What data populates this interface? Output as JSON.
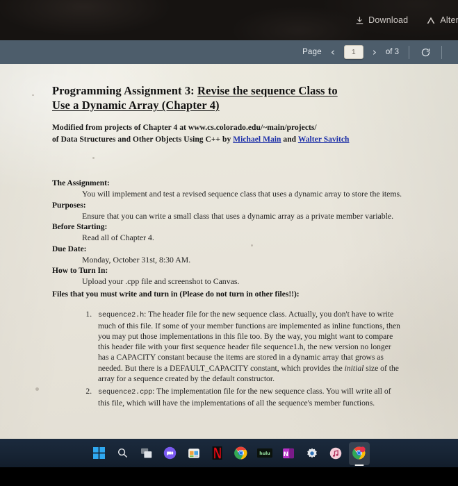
{
  "topbar": {
    "download_label": "Download",
    "alternative_label": "Alternati",
    "download_icon": "download-icon",
    "alternative_icon": "alternative-a-icon"
  },
  "viewer_toolbar": {
    "page_label": "Page",
    "prev_icon": "chevron-left-icon",
    "page_value": "1",
    "next_icon": "chevron-right-icon",
    "of_label": "of 3",
    "total_pages": 3,
    "refresh_icon": "refresh-icon"
  },
  "document": {
    "title_line1_plain": "Programming Assignment 3:  ",
    "title_line1_underlined": "Revise the sequence Class to",
    "title_line2_underlined": "Use a Dynamic Array (Chapter 4)",
    "subtitle_line1": "Modified from projects of Chapter  4  at www.cs.colorado.edu/~main/projects/",
    "subtitle_line2_pre": "of Data Structures and Other Objects Using C++  by ",
    "subtitle_link1": "Michael Main",
    "subtitle_mid": " and ",
    "subtitle_link2": "Walter Savitch",
    "sections": [
      {
        "heading": "The Assignment:",
        "body": "You will implement and test a revised sequence class that uses a dynamic array to store the items."
      },
      {
        "heading": "Purposes:",
        "body": "Ensure that you can write a small class that uses a dynamic array as a private member variable."
      },
      {
        "heading": "Before Starting:",
        "body": "Read all of Chapter 4."
      },
      {
        "heading": "Due Date:",
        "body": "Monday, October 31st, 8:30 AM."
      },
      {
        "heading": "How to Turn In:",
        "body": "Upload your .cpp file and screenshot to Canvas."
      }
    ],
    "files_heading": "Files that you must write and turn in (Please do not turn in other files!!):",
    "files": [
      {
        "filename": "sequence2.h",
        "text_pre": ": The header file for the new sequence class. Actually, you don't have to write much of this file. If some of your member functions are implemented as inline functions, then you may put those implementations in this file too. By the way, you might want to compare this header file with your first sequence header file sequence1.h, the new version no longer has a CAPACITY constant because the items are stored in a dynamic array that grows as needed. But there is a DEFAULT_CAPACITY constant, which provides the ",
        "italic_word": "initial",
        "text_post": " size of the array for a sequence created by the default constructor."
      },
      {
        "filename": "sequence2.cpp",
        "text_pre": ": The implementation file for the new sequence class. You will write all of this file, which will have the implementations of all the sequence's member functions.",
        "italic_word": "",
        "text_post": ""
      }
    ]
  },
  "taskbar": {
    "items": [
      {
        "name": "start-button-icon",
        "label": "Start"
      },
      {
        "name": "search-icon",
        "label": "Search"
      },
      {
        "name": "task-view-icon",
        "label": "Task View"
      },
      {
        "name": "chat-teams-icon",
        "label": "Chat"
      },
      {
        "name": "microsoft-store-icon",
        "label": "Microsoft Store"
      },
      {
        "name": "netflix-icon",
        "label": "Netflix"
      },
      {
        "name": "chrome-icon",
        "label": "Google Chrome"
      },
      {
        "name": "hulu-icon",
        "label": "hulu"
      },
      {
        "name": "onenote-icon",
        "label": "OneNote"
      },
      {
        "name": "settings-gear-icon",
        "label": "Settings"
      },
      {
        "name": "music-icon",
        "label": "Music"
      },
      {
        "name": "chrome-active-icon",
        "label": "Google Chrome"
      }
    ]
  },
  "colors": {
    "toolbar_bg": "#4d5d6b",
    "topbar_bg": "#161311",
    "page_bg": "#e9e6dd",
    "taskbar_bg": "#172434",
    "link": "#1b2ea8"
  }
}
